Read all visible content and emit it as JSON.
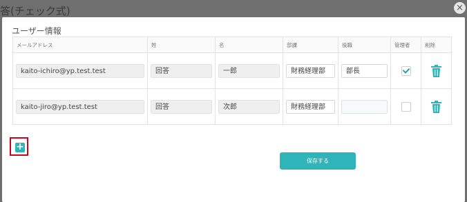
{
  "backdrop": {
    "title": "答(チェック式)"
  },
  "close_icon": "×",
  "section_title": "ユーザー情報",
  "columns": [
    "メールアドレス",
    "姓",
    "名",
    "部課",
    "役職",
    "管理者",
    "削除"
  ],
  "rows": [
    {
      "email": "kaito-ichiro@yp.test.test",
      "last": "回答",
      "first": "一郎",
      "dept": "財務経理部",
      "position": "部長",
      "admin": true
    },
    {
      "email": "kaito-jiro@yp.test.test",
      "last": "回答",
      "first": "次郎",
      "dept": "財務経理部",
      "position": "",
      "admin": false
    }
  ],
  "add_icon": "+",
  "save_label": "保存する",
  "colors": {
    "accent": "#2fb5b9",
    "highlight": "#d0021b"
  }
}
